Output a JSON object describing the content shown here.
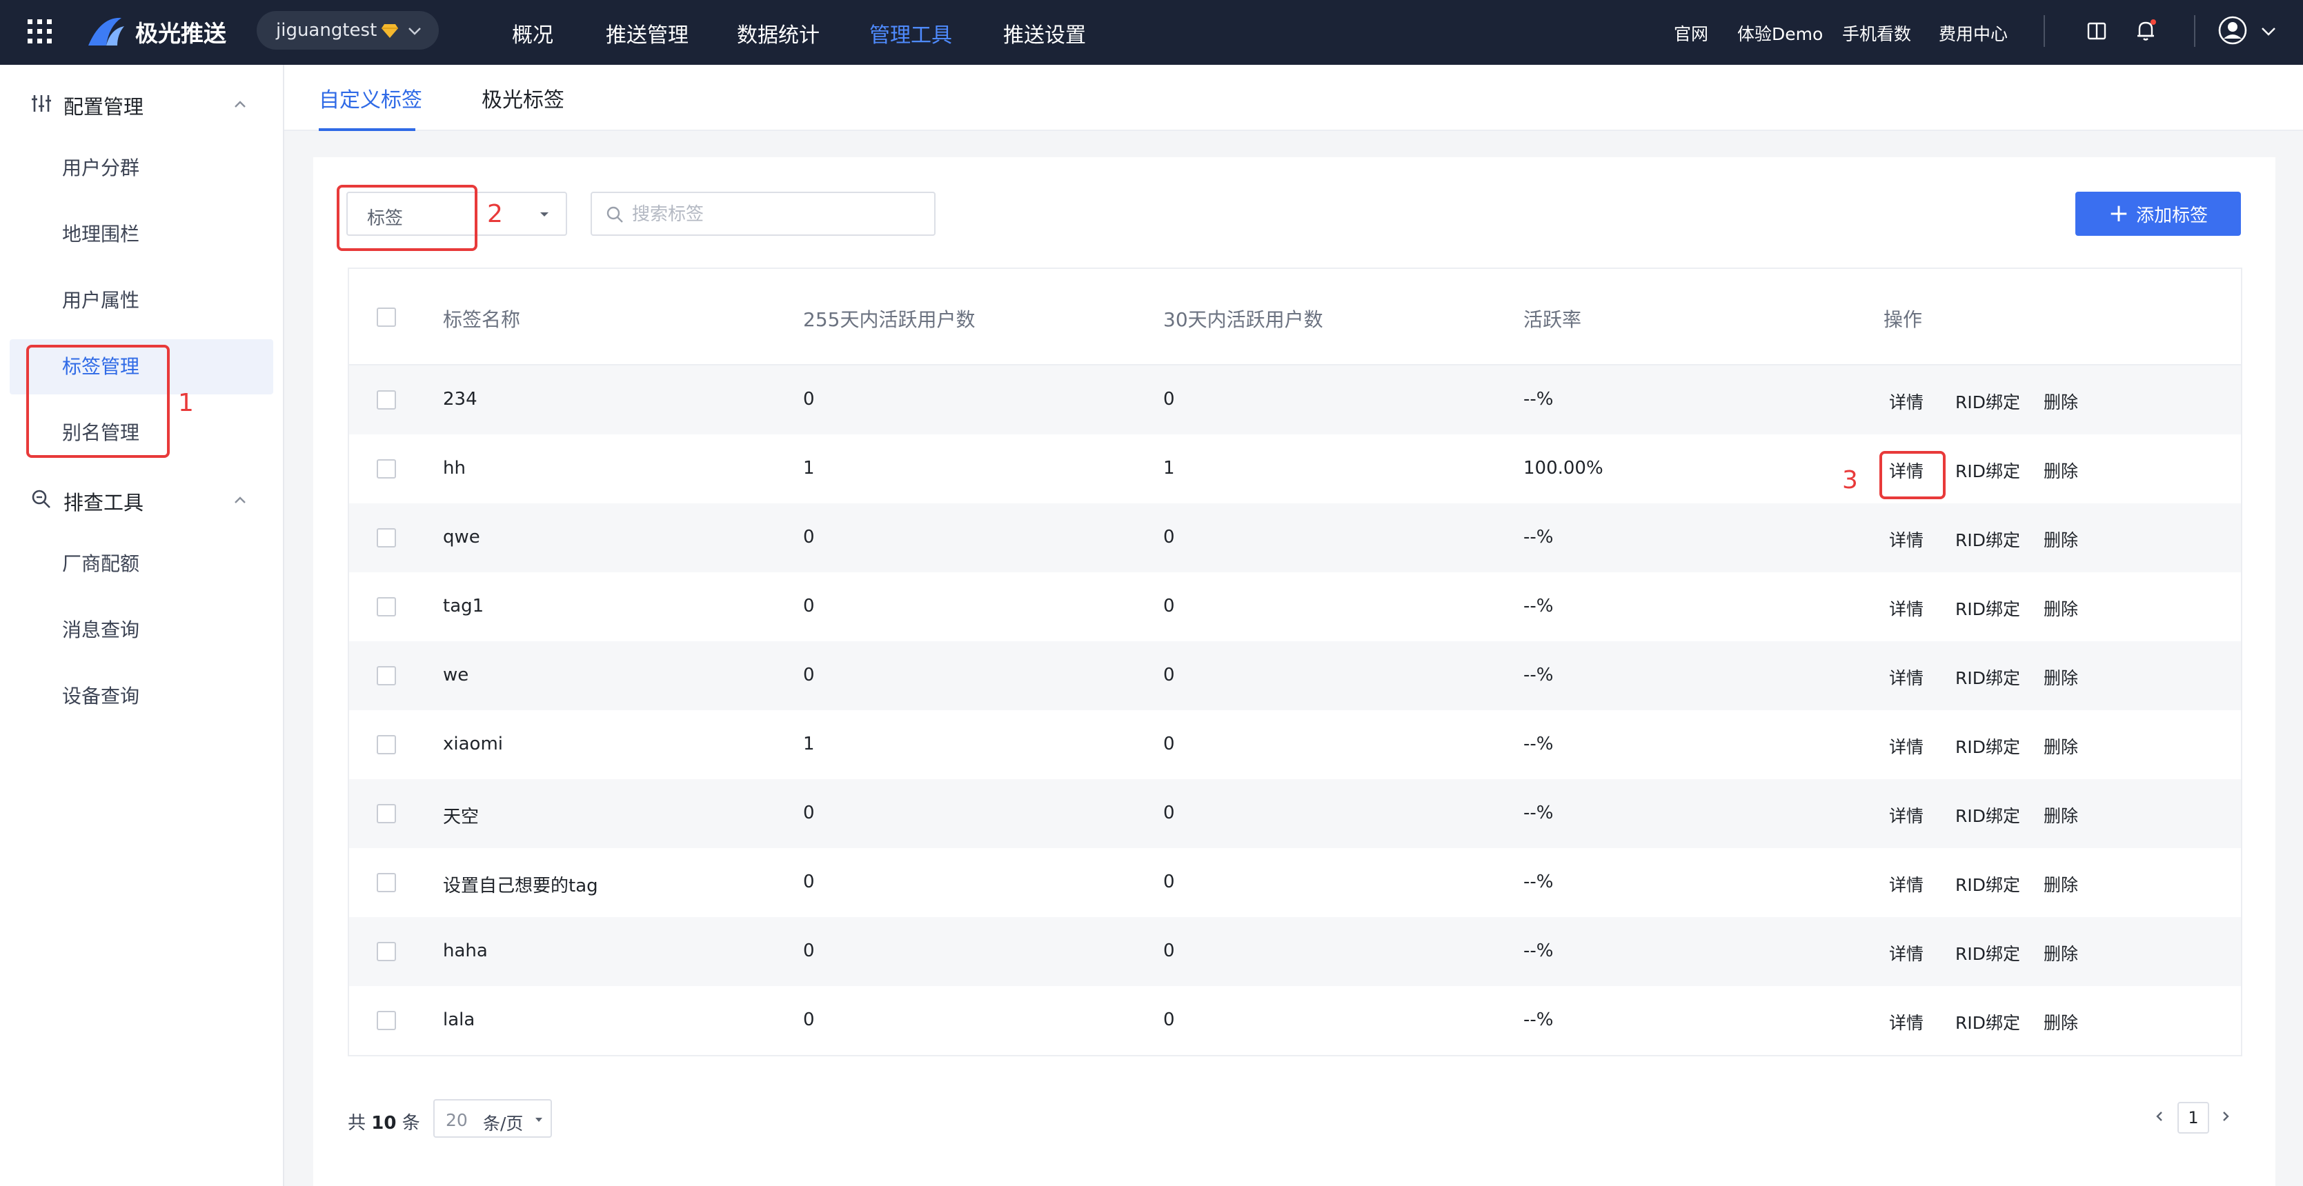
{
  "topbar": {
    "brand": "极光推送",
    "app_name": "jiguangtest",
    "nav": [
      "概况",
      "推送管理",
      "数据统计",
      "管理工具",
      "推送设置"
    ],
    "active_nav_index": 3,
    "links": [
      "官网",
      "体验Demo",
      "手机看数",
      "费用中心"
    ],
    "icons": [
      "apps-grid-icon",
      "book-icon",
      "bell-icon",
      "user-avatar-icon",
      "chevron-down-icon"
    ]
  },
  "sidebar": {
    "groups": [
      {
        "label": "配置管理",
        "icon": "sliders-icon",
        "items": [
          "用户分群",
          "地理围栏",
          "用户属性",
          "标签管理",
          "别名管理"
        ]
      },
      {
        "label": "排查工具",
        "icon": "zoom-search-icon",
        "items": [
          "厂商配额",
          "消息查询",
          "设备查询"
        ]
      }
    ],
    "active_item": "标签管理"
  },
  "tabs": [
    "自定义标签",
    "极光标签"
  ],
  "active_tab": "自定义标签",
  "toolbar": {
    "select_value": "标签",
    "search_placeholder": "搜索标签",
    "add_button": "添加标签"
  },
  "table": {
    "headers": [
      "标签名称",
      "255天内活跃用户数",
      "30天内活跃用户数",
      "活跃率",
      "操作"
    ],
    "rows": [
      {
        "name": "234",
        "active255": "0",
        "active30": "0",
        "rate": "--%"
      },
      {
        "name": "hh",
        "active255": "1",
        "active30": "1",
        "rate": "100.00%"
      },
      {
        "name": "qwe",
        "active255": "0",
        "active30": "0",
        "rate": "--%"
      },
      {
        "name": "tag1",
        "active255": "0",
        "active30": "0",
        "rate": "--%"
      },
      {
        "name": "we",
        "active255": "0",
        "active30": "0",
        "rate": "--%"
      },
      {
        "name": "xiaomi",
        "active255": "1",
        "active30": "0",
        "rate": "--%"
      },
      {
        "name": "天空",
        "active255": "0",
        "active30": "0",
        "rate": "--%"
      },
      {
        "name": "设置自己想要的tag",
        "active255": "0",
        "active30": "0",
        "rate": "--%"
      },
      {
        "name": "haha",
        "active255": "0",
        "active30": "0",
        "rate": "--%"
      },
      {
        "name": "lala",
        "active255": "0",
        "active30": "0",
        "rate": "--%"
      }
    ],
    "actions": [
      "详情",
      "RID绑定",
      "删除"
    ]
  },
  "pagination": {
    "total_prefix": "共",
    "total": "10",
    "total_suffix": "条",
    "page_size": "20",
    "page_size_unit": "条/页",
    "current_page": "1"
  },
  "annotations": [
    "1",
    "2",
    "3"
  ],
  "colors": {
    "topbar_bg": "#1b2336",
    "accent": "#2f6ae6",
    "primary_button": "#3a6ff0",
    "annotation_red": "#e83a3a"
  }
}
